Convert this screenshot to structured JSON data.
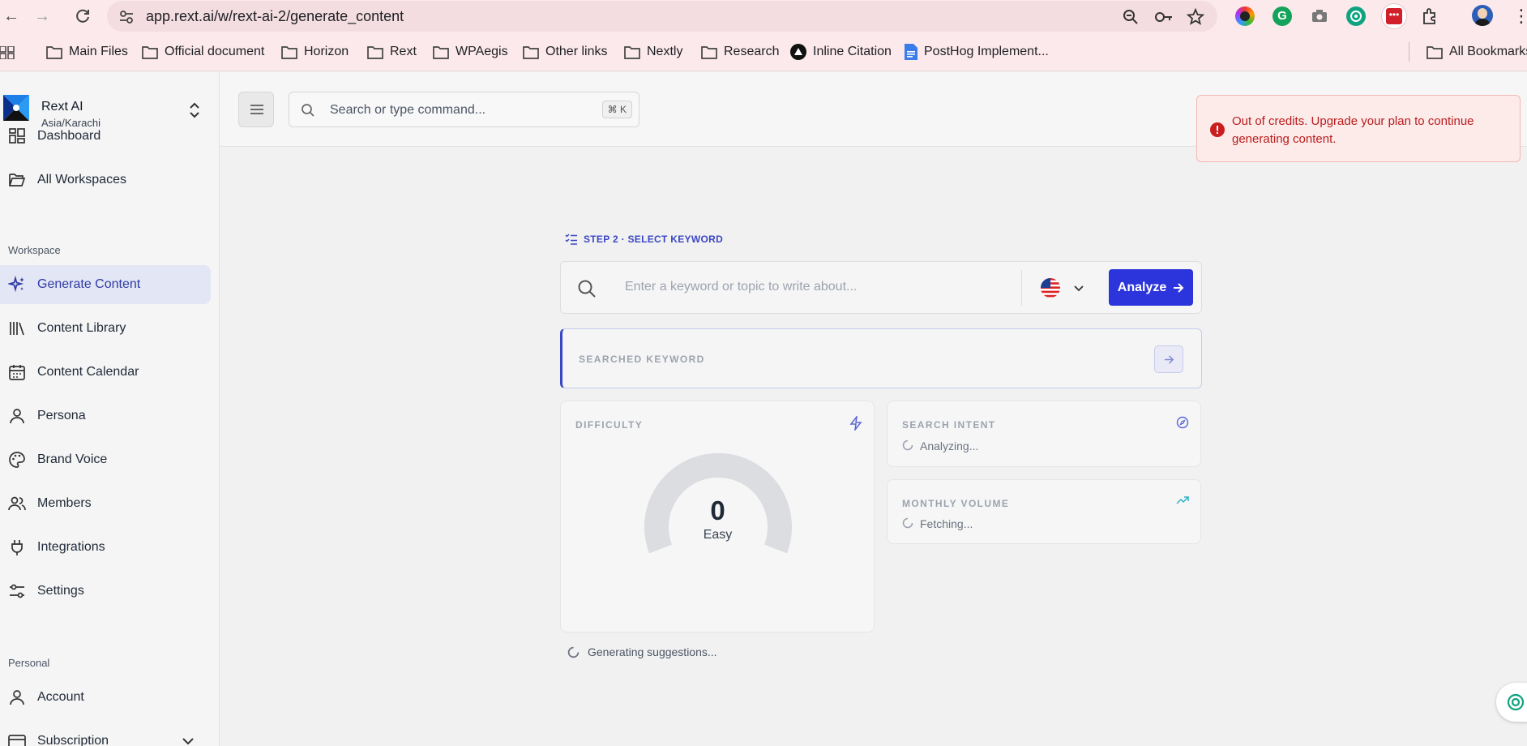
{
  "browser": {
    "url": "app.rext.ai/w/rext-ai-2/generate_content",
    "bookmarks": [
      "Main Files",
      "Official document",
      "Horizon",
      "Rext",
      "WPAegis",
      "Other links",
      "Nextly",
      "Research",
      "Inline Citation",
      "PostHog Implement...",
      "All Bookmarks"
    ]
  },
  "sidebar": {
    "brand_name": "Rext AI",
    "brand_sub": "Asia/Karachi",
    "top_items": [
      "Dashboard",
      "All Workspaces"
    ],
    "workspace_label": "Workspace",
    "workspace_items": [
      "Generate Content",
      "Content Library",
      "Content Calendar",
      "Persona",
      "Brand Voice",
      "Members",
      "Integrations",
      "Settings"
    ],
    "personal_label": "Personal",
    "personal_items": [
      "Account",
      "Subscription"
    ]
  },
  "topbar": {
    "search_placeholder": "Search or type command...",
    "shortcut": "⌘ K"
  },
  "toast": {
    "message": "Out of credits. Upgrade your plan to continue generating content."
  },
  "main": {
    "step_label": "STEP 2 · SELECT KEYWORD",
    "keyword_placeholder": "Enter a keyword or topic to write about...",
    "analyze_label": "Analyze",
    "searched_label": "SEARCHED KEYWORD",
    "difficulty": {
      "title": "DIFFICULTY",
      "value": "0",
      "label": "Easy",
      "level": 0
    },
    "intent": {
      "title": "SEARCH INTENT",
      "status": "Analyzing..."
    },
    "volume": {
      "title": "MONTHLY VOLUME",
      "status": "Fetching..."
    },
    "generating": "Generating suggestions..."
  },
  "colors": {
    "accent": "#2b35db",
    "error": "#b91c1c"
  }
}
